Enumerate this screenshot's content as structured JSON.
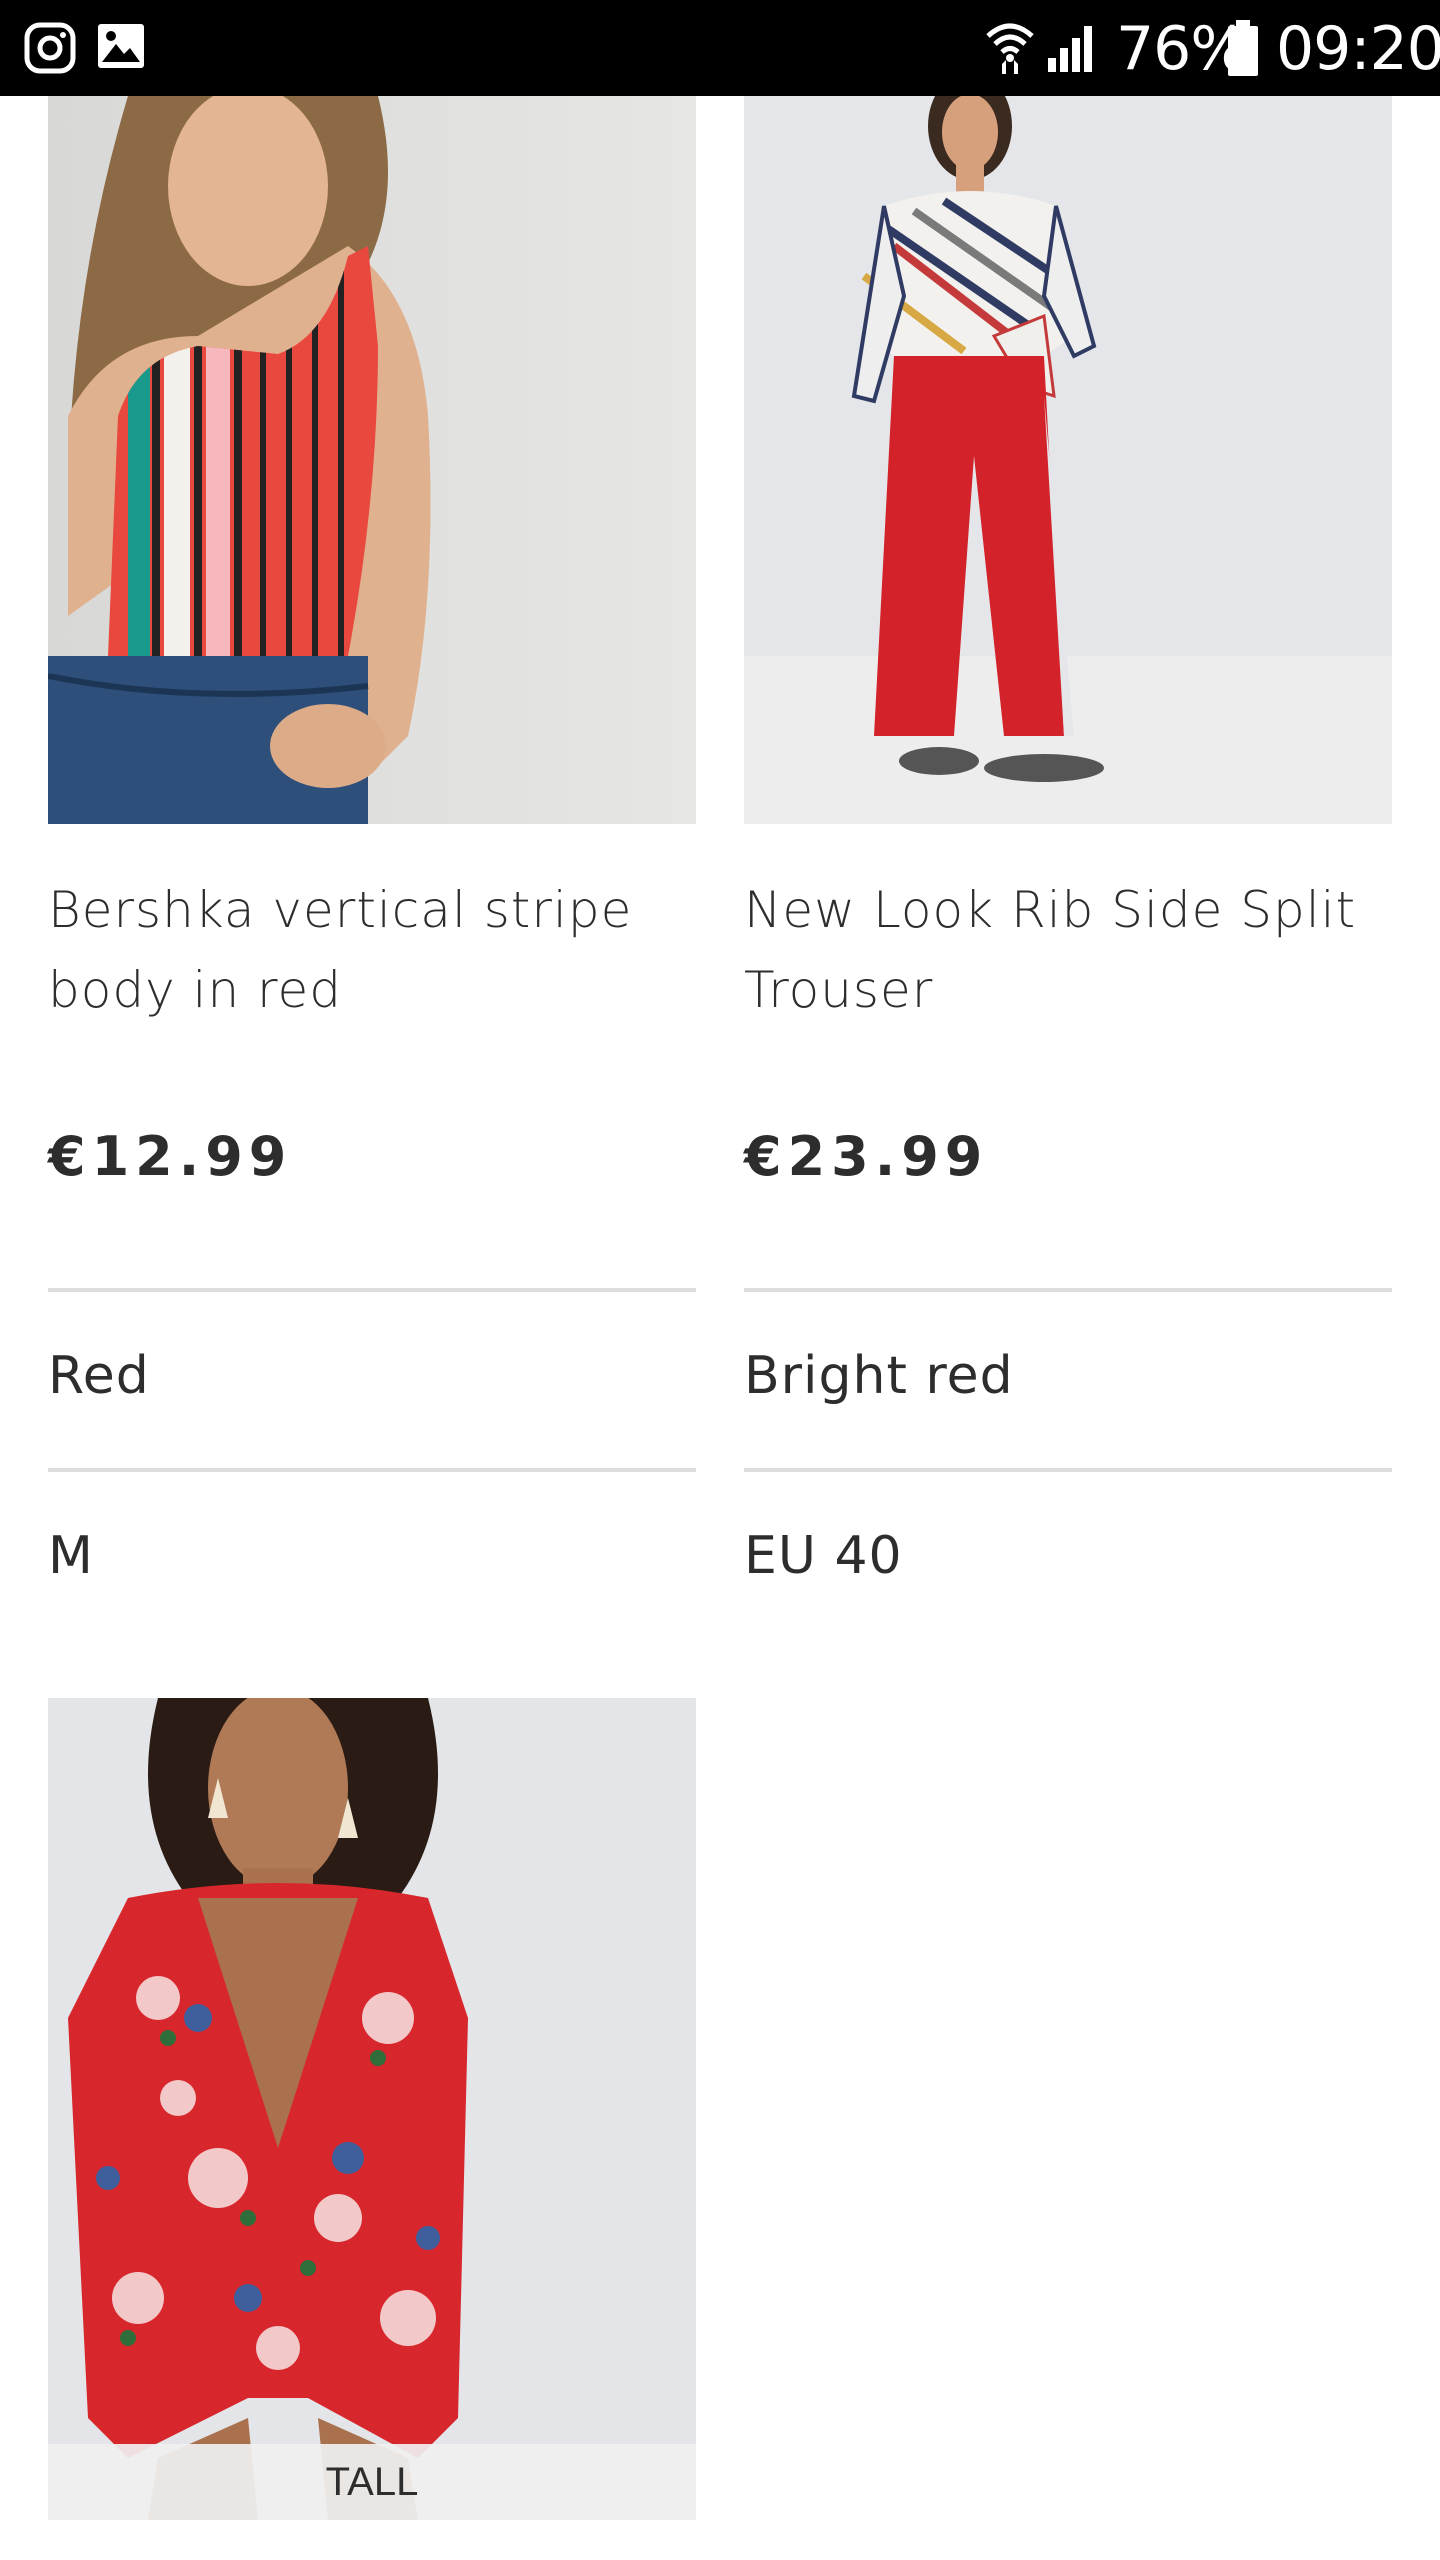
{
  "status_bar": {
    "battery": "76%",
    "time": "09:20",
    "icons": [
      "instagram-icon",
      "gallery-icon",
      "wifi-icon",
      "signal-icon",
      "battery-icon"
    ]
  },
  "products": [
    {
      "name": "Bershka vertical stripe body in red",
      "price": "€12.99",
      "color": "Red",
      "size": "M"
    },
    {
      "name": "New Look Rib Side Split Trouser",
      "price": "€23.99",
      "color": "Bright red",
      "size": "EU 40"
    },
    {
      "tag": "TALL"
    }
  ],
  "colors": {
    "text": "#2d2d2d",
    "divider": "#dddddd",
    "status_bar": "#000000"
  }
}
